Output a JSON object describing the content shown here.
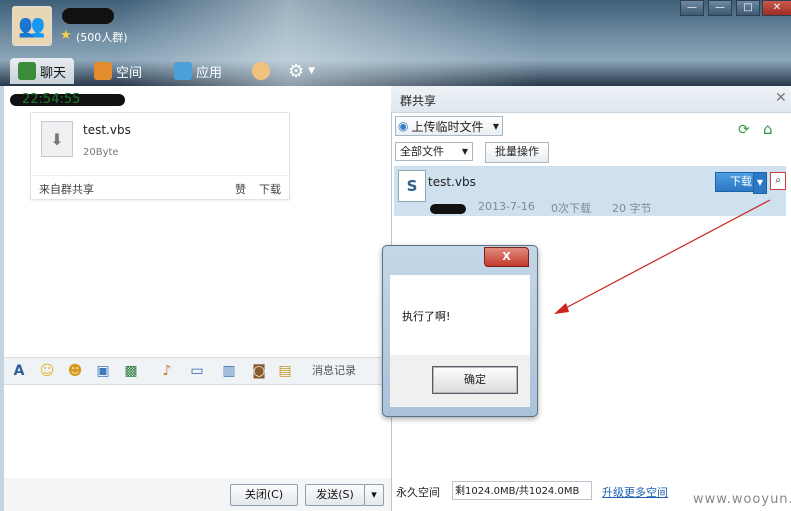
{
  "header": {
    "group_count": "(500人群)",
    "tabs": [
      "聊天",
      "空间",
      "应用"
    ]
  },
  "window_controls": {
    "minimize": "—",
    "maximize": "□",
    "close": "✕"
  },
  "chat": {
    "timestamp": "22:54:55",
    "file_card": {
      "name": "test.vbs",
      "size": "20Byte",
      "from": "来自群共享",
      "like": "赞",
      "download": "下载"
    },
    "toolbar": {
      "message_record": "消息记录"
    },
    "buttons": {
      "close": "关闭(C)",
      "send": "发送(S)"
    }
  },
  "share_panel": {
    "title": "群共享",
    "upload_button": "上传临时文件",
    "filter": "全部文件",
    "batch_button": "批量操作",
    "file": {
      "name": "test.vbs",
      "date": "2013-7-16",
      "downloads": "0次下载",
      "size": "20 字节",
      "download_button": "下载"
    },
    "space_label": "永久空间",
    "space_value": "剩1024.0MB/共1024.0MB",
    "upgrade_link": "升级更多空间"
  },
  "dialog": {
    "message": "执行了啊!",
    "ok": "确定",
    "close": "X"
  },
  "watermark": "www.wooyun.org"
}
